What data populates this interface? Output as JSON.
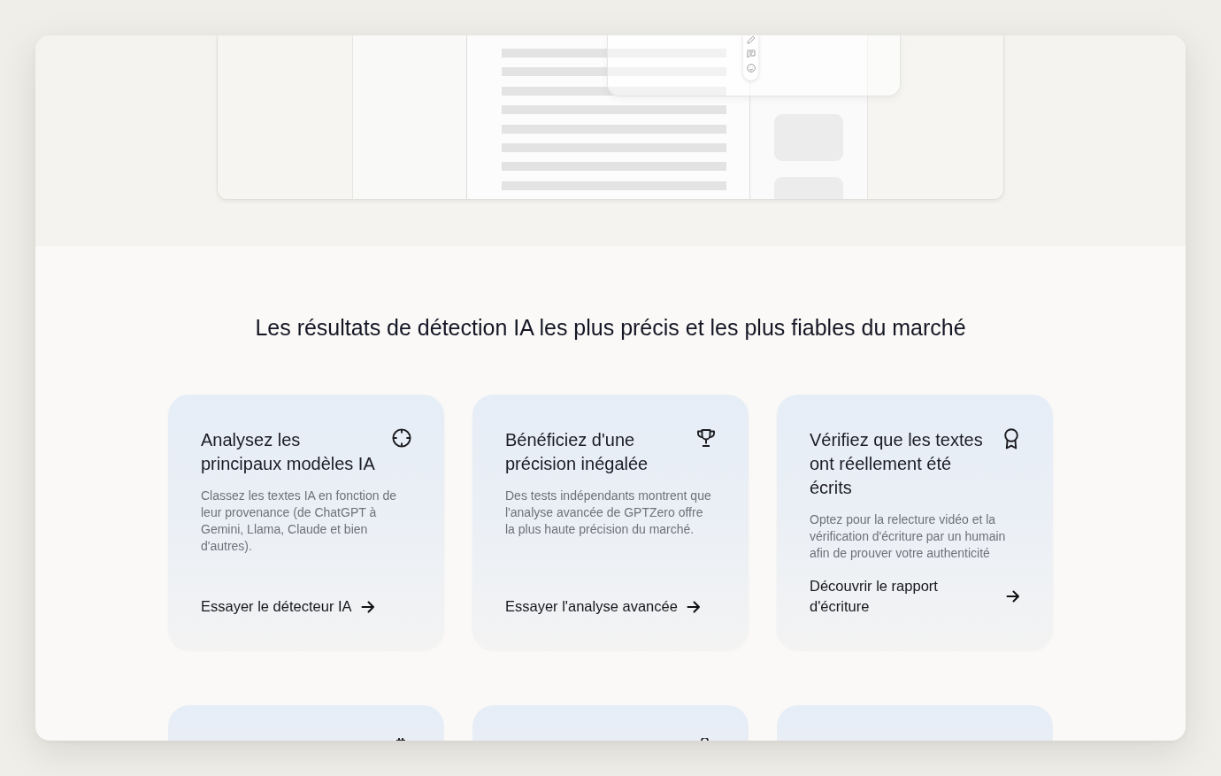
{
  "section": {
    "heading": "Les résultats de détection IA les plus précis et les plus fiables du marché"
  },
  "cards": [
    {
      "kind": "feature",
      "title": "Analysez les principaux modèles IA",
      "description": "Classez les textes IA en fonction de leur provenance (de ChatGPT à Gemini, Llama, Claude et bien d'autres).",
      "link": "Essayer le détecteur IA"
    },
    {
      "kind": "feature",
      "title": "Bénéficiez d'une précision inégalée",
      "description": "Des tests indépendants montrent que l'analyse avancée de GPTZero offre la plus haute précision du marché.",
      "link": "Essayer l'analyse avancée"
    },
    {
      "kind": "feature",
      "title": "Vérifiez que les textes ont réellement été écrits",
      "description": "Optez pour la relecture vidéo et la vérification d'écriture par un humain afin de prouver votre authenticité",
      "link": "Découvrir le rapport d'écriture"
    },
    {
      "kind": "partial"
    },
    {
      "kind": "partial"
    },
    {
      "kind": "partial"
    }
  ]
}
